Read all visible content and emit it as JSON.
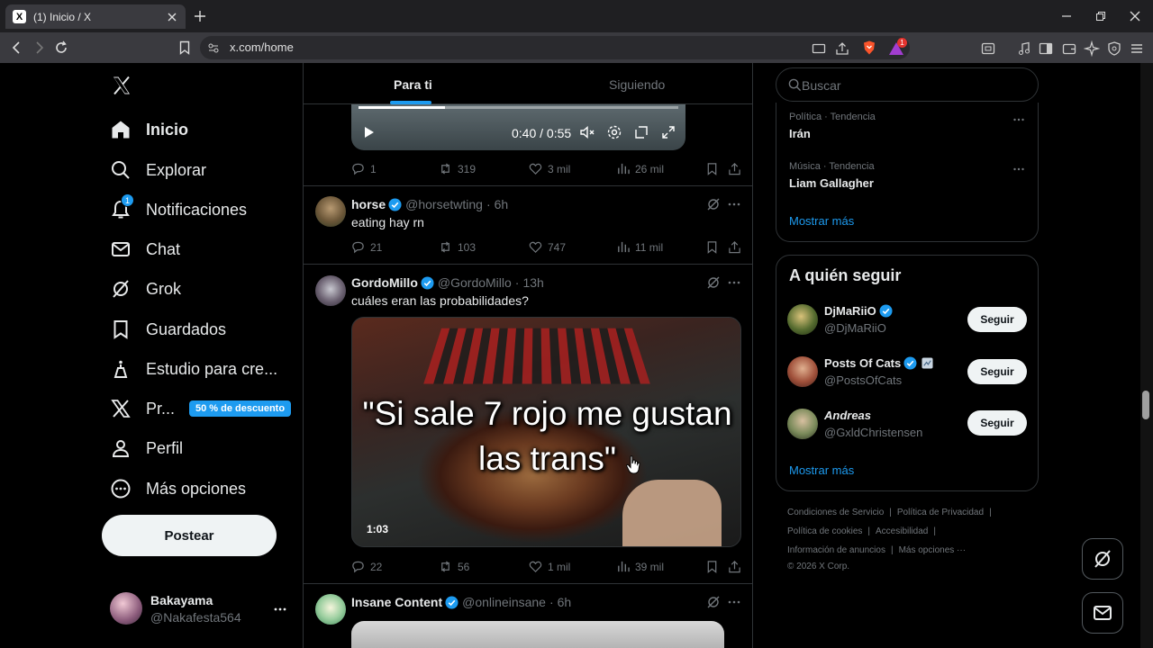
{
  "browser": {
    "tab_title": "(1) Inicio / X",
    "tab_favicon": "X",
    "url": "x.com/home",
    "extension_badge": "1"
  },
  "nav": {
    "items": [
      {
        "label": "Inicio",
        "icon": "home-icon",
        "active": true
      },
      {
        "label": "Explorar",
        "icon": "search-icon"
      },
      {
        "label": "Notificaciones",
        "icon": "bell-icon",
        "badge": "1"
      },
      {
        "label": "Chat",
        "icon": "mail-icon"
      },
      {
        "label": "Grok",
        "icon": "grok-icon"
      },
      {
        "label": "Guardados",
        "icon": "bookmark-icon"
      },
      {
        "label": "Estudio para cre...",
        "icon": "creator-studio-icon"
      },
      {
        "label": "Pr...",
        "icon": "x-logo-icon",
        "promo": "50 % de descuento"
      },
      {
        "label": "Perfil",
        "icon": "profile-icon"
      },
      {
        "label": "Más opciones",
        "icon": "more-options-icon"
      }
    ],
    "post_button": "Postear",
    "account": {
      "name": "Bakayama",
      "handle": "@Nakafesta564"
    }
  },
  "feed": {
    "tabs": [
      {
        "label": "Para ti",
        "active": true
      },
      {
        "label": "Siguiendo",
        "active": false
      }
    ],
    "video_player": {
      "time": "0:40 / 0:55",
      "progress": 0.27
    },
    "tweets": [
      {
        "stats": {
          "replies": "1",
          "reposts": "319",
          "likes": "3 mil",
          "views": "26 mil"
        }
      },
      {
        "name": "horse",
        "handle": "@horsetwting",
        "time": "6h",
        "text": "eating hay rn",
        "stats": {
          "replies": "21",
          "reposts": "103",
          "likes": "747",
          "views": "11 mil"
        }
      },
      {
        "name": "GordoMillo",
        "handle": "@GordoMillo",
        "time": "13h",
        "text": "cuáles eran las probabilidades?",
        "media_caption_line1": "\"Si sale 7 rojo me gustan",
        "media_caption_line2": "las trans\"",
        "media_duration": "1:03",
        "stats": {
          "replies": "22",
          "reposts": "56",
          "likes": "1 mil",
          "views": "39 mil"
        }
      },
      {
        "name": "Insane Content",
        "handle": "@onlineinsane",
        "time": "6h"
      }
    ]
  },
  "sidebar": {
    "search_placeholder": "Buscar",
    "trends": [
      {
        "category": "Política · Tendencia",
        "name": "Irán"
      },
      {
        "category": "Música · Tendencia",
        "name": "Liam Gallagher"
      }
    ],
    "trends_show_more": "Mostrar más",
    "who_to_follow": {
      "title": "A quién seguir",
      "users": [
        {
          "name": "DjMaRiiO",
          "handle": "@DjMaRiiO",
          "verified": true
        },
        {
          "name": "Posts Of Cats",
          "handle": "@PostsOfCats",
          "verified": true
        },
        {
          "name": "Andreas",
          "handle": "@GxldChristensen",
          "verified": false
        }
      ],
      "follow_label": "Seguir",
      "show_more": "Mostrar más"
    },
    "footer": {
      "line1": [
        "Condiciones de Servicio",
        "Política de Privacidad"
      ],
      "line2": [
        "Política de cookies",
        "Accesibilidad"
      ],
      "line3": [
        "Información de anuncios",
        "Más opciones ···"
      ],
      "copyright": "© 2026 X Corp."
    }
  },
  "colors": {
    "accent": "#1d9bf0",
    "background": "#000000",
    "text": "#e7e9ea",
    "muted": "#71767b",
    "border": "#2f3336"
  }
}
